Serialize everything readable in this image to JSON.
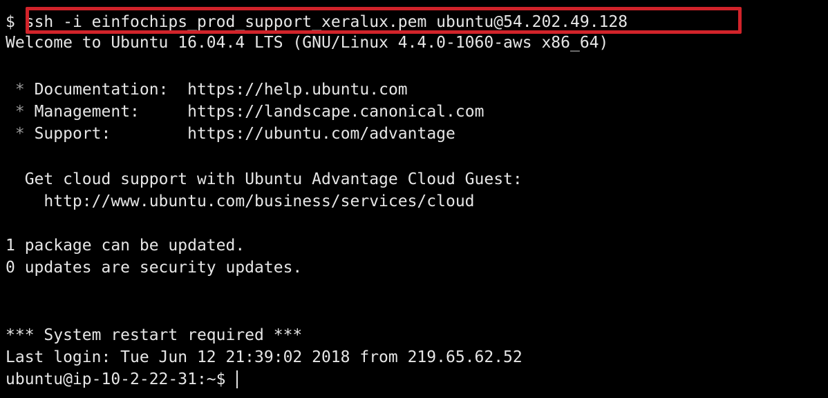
{
  "terminal": {
    "command_line": {
      "prompt": "$",
      "command": "ssh -i einfochips_prod_support_xeralux.pem ubuntu@54.202.49.128",
      "highlight_color": "#d1232a"
    },
    "welcome": "Welcome to Ubuntu 16.04.4 LTS (GNU/Linux 4.4.0-1060-aws x86_64)",
    "links": [
      {
        "bullet": "*",
        "label": "Documentation:",
        "url": "https://help.ubuntu.com"
      },
      {
        "bullet": "*",
        "label": "Management:",
        "url": "https://landscape.canonical.com"
      },
      {
        "bullet": "*",
        "label": "Support:",
        "url": "https://ubuntu.com/advantage"
      }
    ],
    "cloud_support": "Get cloud support with Ubuntu Advantage Cloud Guest:",
    "cloud_url": "http://www.ubuntu.com/business/services/cloud",
    "updates": [
      "1 package can be updated.",
      "0 updates are security updates."
    ],
    "restart_notice": "*** System restart required ***",
    "last_login": "Last login: Tue Jun 12 21:39:02 2018 from 219.65.62.52",
    "shell_prompt": "ubuntu@ip-10-2-22-31:~$"
  }
}
